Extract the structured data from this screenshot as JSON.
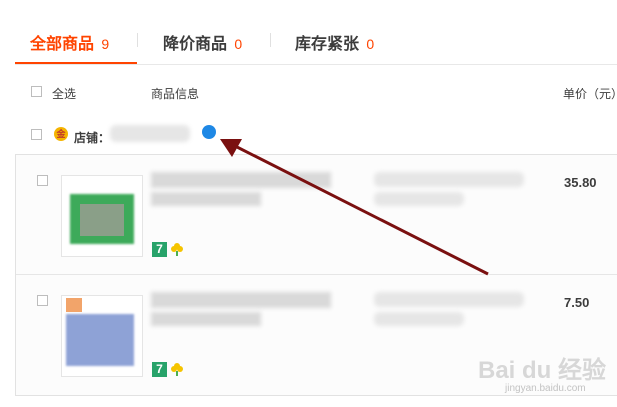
{
  "tabs": [
    {
      "label": "全部商品",
      "count": "9",
      "active": true
    },
    {
      "label": "降价商品",
      "count": "0",
      "active": false
    },
    {
      "label": "库存紧张",
      "count": "0",
      "active": false
    }
  ],
  "header": {
    "select_all": "全选",
    "product_info": "商品信息",
    "unit_price": "单价（元）"
  },
  "shop": {
    "label": "店铺："
  },
  "items": [
    {
      "price": "35.80",
      "badge": "7"
    },
    {
      "price": "7.50",
      "badge": "7"
    }
  ],
  "watermark": {
    "text": "Bai du 经验",
    "subtext": "jingyan.baidu.com"
  },
  "colors": {
    "accent": "#f40",
    "arrow": "#7a1010",
    "badge_green": "#27a36a"
  }
}
